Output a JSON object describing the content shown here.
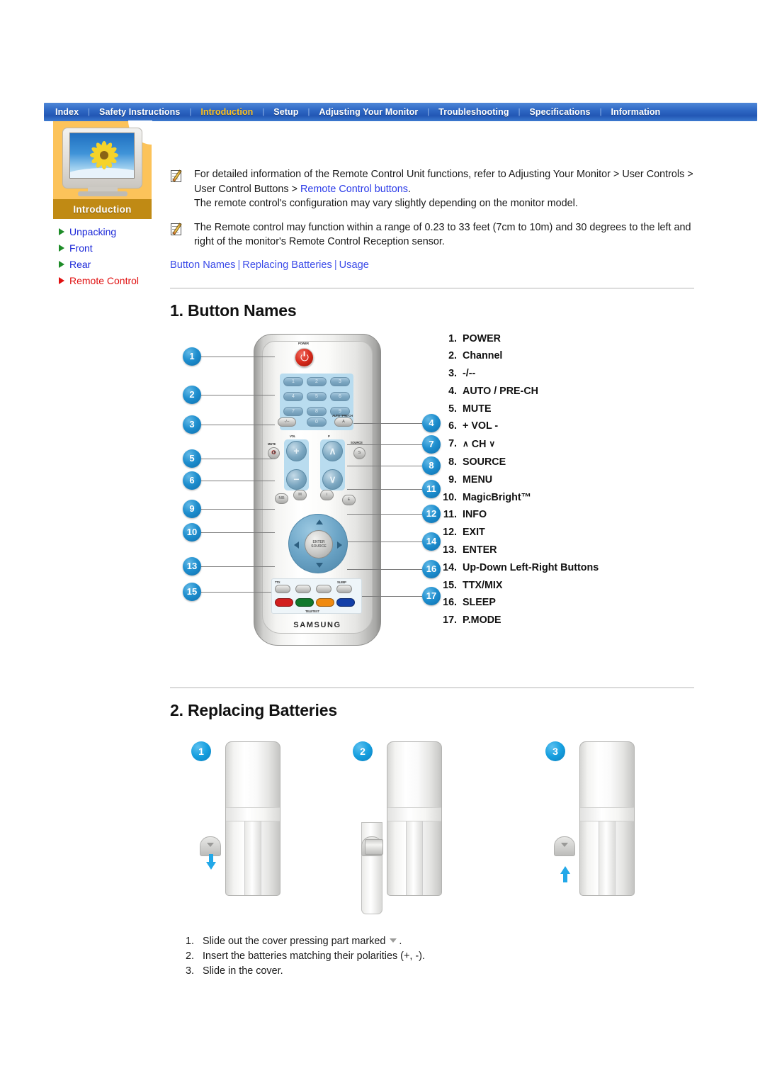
{
  "nav": {
    "separator": "|",
    "items": [
      {
        "label": "Index",
        "active": false
      },
      {
        "label": "Safety Instructions",
        "active": false
      },
      {
        "label": "Introduction",
        "active": true
      },
      {
        "label": "Setup",
        "active": false
      },
      {
        "label": "Adjusting Your Monitor",
        "active": false
      },
      {
        "label": "Troubleshooting",
        "active": false
      },
      {
        "label": "Specifications",
        "active": false
      },
      {
        "label": "Information",
        "active": false
      }
    ]
  },
  "sidebar": {
    "caption": "Introduction",
    "items": [
      {
        "label": "Unpacking",
        "current": false
      },
      {
        "label": "Front",
        "current": false
      },
      {
        "label": "Rear",
        "current": false
      },
      {
        "label": "Remote Control",
        "current": true
      }
    ]
  },
  "notes": [
    {
      "text_before": "For detailed information of the Remote Control Unit functions, refer to Adjusting Your Monitor > User Controls > User Control Buttons > ",
      "link": "Remote Control buttons",
      "text_after": ".",
      "line2": "The remote control's configuration may vary slightly depending on the monitor model."
    },
    {
      "text_before": "The Remote control may function within a range of 0.23 to 33 feet (7cm to 10m) and 30 degrees to the left and right of the monitor's Remote Control Reception sensor.",
      "link": "",
      "text_after": "",
      "line2": ""
    }
  ],
  "crumbs": [
    {
      "label": "Button Names"
    },
    {
      "label": "Replacing Batteries"
    },
    {
      "label": "Usage"
    }
  ],
  "section1": {
    "title": "1. Button Names",
    "buttons": [
      {
        "num": "1.",
        "name": "POWER"
      },
      {
        "num": "2.",
        "name": "Channel"
      },
      {
        "num": "3.",
        "name": "-/--"
      },
      {
        "num": "4.",
        "name": "AUTO / PRE-CH"
      },
      {
        "num": "5.",
        "name": "MUTE"
      },
      {
        "num": "6.",
        "name": "+ VOL -"
      },
      {
        "num": "7.",
        "name": "CH"
      },
      {
        "num": "8.",
        "name": "SOURCE"
      },
      {
        "num": "9.",
        "name": "MENU"
      },
      {
        "num": "10.",
        "name": "MagicBright™"
      },
      {
        "num": "11.",
        "name": "INFO"
      },
      {
        "num": "12.",
        "name": "EXIT"
      },
      {
        "num": "13.",
        "name": "ENTER"
      },
      {
        "num": "14.",
        "name": "Up-Down Left-Right Buttons"
      },
      {
        "num": "15.",
        "name": "TTX/MIX"
      },
      {
        "num": "16.",
        "name": "SLEEP"
      },
      {
        "num": "17.",
        "name": "P.MODE"
      }
    ],
    "remote": {
      "brand": "SAMSUNG",
      "power_label": "POWER",
      "auto_label": "AUTO / PRE-CH",
      "keys": [
        "1",
        "2",
        "3",
        "4",
        "5",
        "6",
        "7",
        "8",
        "9",
        "0"
      ],
      "dash_key": "-/--",
      "auto_key": "A",
      "mute_label": "MUTE",
      "vol_plus": "+",
      "vol_minus": "−",
      "ch_up": "∧",
      "ch_down": "∨",
      "enter_label": "ENTER",
      "enter_sub": "SOURCE",
      "src_key": "S",
      "info_key": "i",
      "menu_key": "M",
      "exit_key": "E",
      "mb_key": "MB",
      "ttx_key": "TTX",
      "sleep_key": "SLEEP",
      "color_buttons": [
        {
          "name": "red-button",
          "color": "#d21f1f"
        },
        {
          "name": "green-button",
          "color": "#11792c"
        },
        {
          "name": "orange-button",
          "color": "#f08a10"
        },
        {
          "name": "blue-button",
          "color": "#123fa8"
        }
      ],
      "callouts_left": [
        "1",
        "2",
        "3",
        "5",
        "6",
        "9",
        "10",
        "13",
        "15"
      ],
      "callouts_right": [
        "4",
        "7",
        "8",
        "11",
        "12",
        "14",
        "16",
        "17"
      ]
    }
  },
  "section2": {
    "title": "2. Replacing Batteries",
    "steps_figures": [
      "1",
      "2",
      "3"
    ],
    "steps": [
      {
        "num": "1.",
        "before": "Slide out the cover pressing part marked ",
        "after": "."
      },
      {
        "num": "2.",
        "before": "Insert the batteries matching their polarities (+, -).",
        "after": ""
      },
      {
        "num": "3.",
        "before": "Slide in the cover.",
        "after": ""
      }
    ]
  },
  "colors": {
    "nav_active": "#ffc21f",
    "link": "#2a3ae8",
    "sidebar_panel": "#fcc35a",
    "sidebar_caption": "#c08a14",
    "current_item": "#e01010"
  }
}
